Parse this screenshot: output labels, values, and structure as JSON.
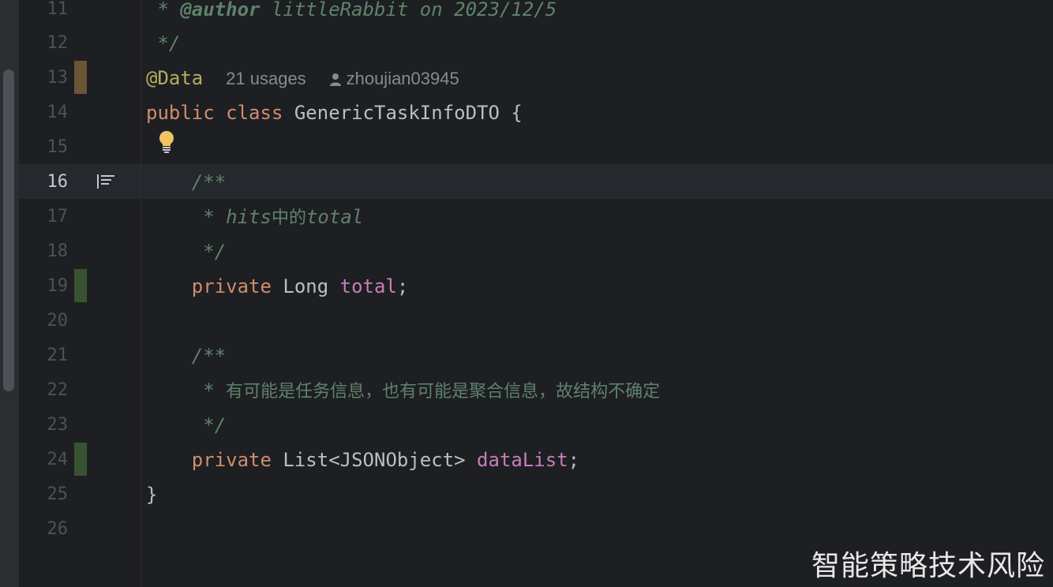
{
  "editor": {
    "current_line": 16,
    "lines": [
      {
        "n": "11"
      },
      {
        "n": "12"
      },
      {
        "n": "13"
      },
      {
        "n": "14"
      },
      {
        "n": "15"
      },
      {
        "n": "16"
      },
      {
        "n": "17"
      },
      {
        "n": "18"
      },
      {
        "n": "19"
      },
      {
        "n": "20"
      },
      {
        "n": "21"
      },
      {
        "n": "22"
      },
      {
        "n": "23"
      },
      {
        "n": "24"
      },
      {
        "n": "25"
      },
      {
        "n": "26"
      }
    ],
    "code": {
      "l11_prefix": " * ",
      "l11_tag": "@author",
      "l11_text": " littleRabbit on 2023/12/5",
      "l12": " */",
      "l13_annotation": "@Data",
      "l13_usages": "21 usages",
      "l13_author": "zhoujian03945",
      "l14_kw1": "public",
      "l14_kw2": "class",
      "l14_rest": "GenericTaskInfoDTO {",
      "l16": "    /**",
      "l17_prefix": "     * ",
      "l17_a": "hits",
      "l17_cjk": "中的",
      "l17_b": "total",
      "l18": "     */",
      "l19_kw": "private",
      "l19_type": "Long",
      "l19_field": "total",
      "l19_end": ";",
      "l21": "    /**",
      "l22_prefix": "     * ",
      "l22_cjk": "有可能是任务信息，也有可能是聚合信息，故结构不确定",
      "l23": "     */",
      "l24_kw": "private",
      "l24_type": "List<JSONObject>",
      "l24_field": "dataList",
      "l24_end": ";",
      "l25": "}"
    },
    "icons": {
      "line13_author": "user-icon",
      "line15_intention": "lightbulb-icon",
      "line16_gutter": "structure-icon"
    }
  },
  "watermark": "智能策略技术风险",
  "colors": {
    "background": "#1e1f22",
    "keyword": "#cf8e6d",
    "annotation": "#b3ae60",
    "field": "#c77dbb",
    "comment": "#5f826b",
    "vcs_modified": "#6b5537",
    "vcs_added": "#385331"
  }
}
